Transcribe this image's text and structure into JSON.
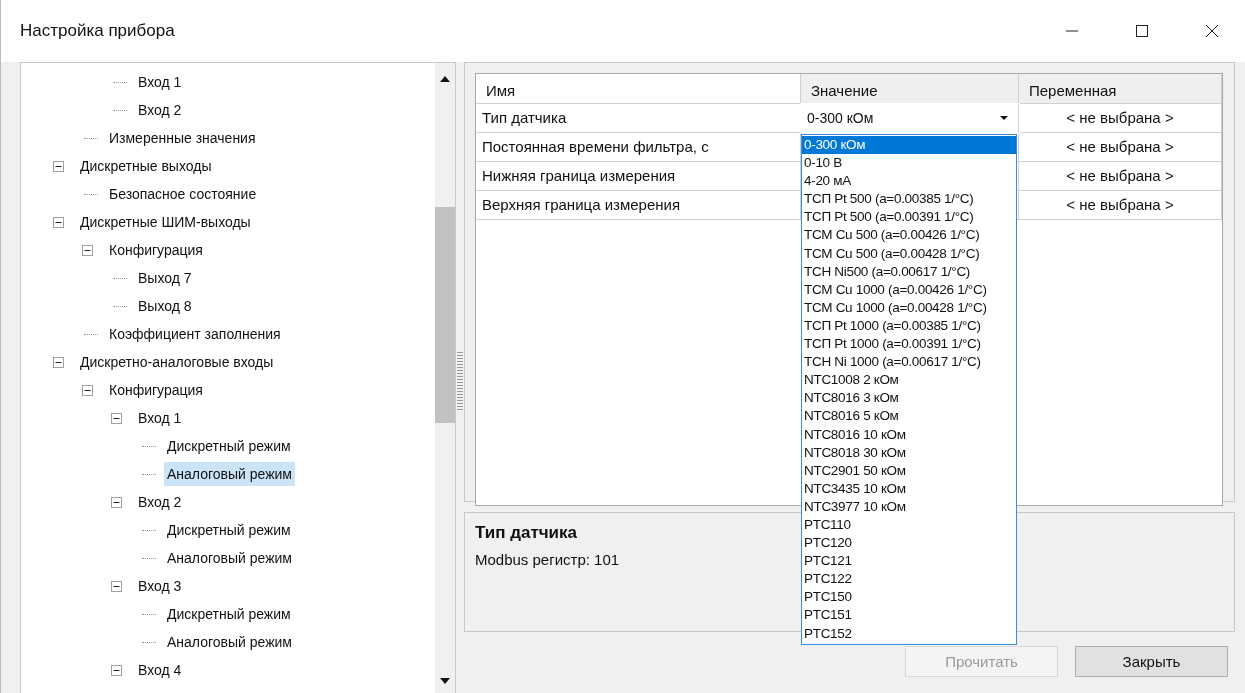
{
  "window": {
    "title": "Настройка прибора"
  },
  "tree": {
    "items": [
      {
        "children": [
          {
            "children": [
              {
                "label": "Вход 1",
                "selected": false
              },
              {
                "label": "Вход 2",
                "selected": false
              }
            ]
          },
          {
            "label": "Измеренные значения",
            "selected": false
          }
        ]
      },
      {
        "label": "Дискретные выходы",
        "expanded": true,
        "selected": false,
        "children": [
          {
            "label": "Безопасное состояние",
            "selected": false
          }
        ]
      },
      {
        "label": "Дискретные ШИМ-выходы",
        "expanded": true,
        "selected": false,
        "children": [
          {
            "label": "Конфигурация",
            "expanded": true,
            "selected": false,
            "children": [
              {
                "label": "Выход 7",
                "selected": false
              },
              {
                "label": "Выход 8",
                "selected": false
              }
            ]
          },
          {
            "label": "Коэффициент заполнения",
            "selected": false
          }
        ]
      },
      {
        "label": "Дискретно-аналоговые входы",
        "expanded": true,
        "selected": false,
        "children": [
          {
            "label": "Конфигурация",
            "expanded": true,
            "selected": false,
            "children": [
              {
                "label": "Вход 1",
                "expanded": true,
                "selected": false,
                "children": [
                  {
                    "label": "Дискретный режим",
                    "selected": false
                  },
                  {
                    "label": "Аналоговый режим",
                    "selected": true
                  }
                ]
              },
              {
                "label": "Вход 2",
                "expanded": true,
                "selected": false,
                "children": [
                  {
                    "label": "Дискретный режим",
                    "selected": false
                  },
                  {
                    "label": "Аналоговый режим",
                    "selected": false
                  }
                ]
              },
              {
                "label": "Вход 3",
                "expanded": true,
                "selected": false,
                "children": [
                  {
                    "label": "Дискретный режим",
                    "selected": false
                  },
                  {
                    "label": "Аналоговый режим",
                    "selected": false
                  }
                ]
              },
              {
                "label": "Вход 4",
                "expanded": true,
                "selected": false
              }
            ]
          }
        ]
      }
    ]
  },
  "grid": {
    "columns": [
      "Имя",
      "Значение",
      "Переменная"
    ],
    "rows": [
      {
        "kind": "combo",
        "name": "Тип датчика",
        "value": "0-300 кОм",
        "variable": "< не выбрана >",
        "expanded": true
      },
      {
        "kind": "text",
        "name": "Постоянная времени фильтра, с",
        "variable": "< не выбрана >"
      },
      {
        "kind": "text",
        "name": "Нижняя граница измерения",
        "variable": "< не выбрана >"
      },
      {
        "kind": "text",
        "name": "Верхняя граница измерения",
        "variable": "< не выбрана >"
      }
    ]
  },
  "dropdown": {
    "options": [
      {
        "label": "0-300 кОм",
        "selected": true
      },
      {
        "label": "0-10 В",
        "selected": false
      },
      {
        "label": "4-20 мА",
        "selected": false
      },
      {
        "label": "ТСП Pt 500 (a=0.00385 1/°C)",
        "selected": false
      },
      {
        "label": "ТСП Pt 500 (a=0.00391 1/°C)",
        "selected": false
      },
      {
        "label": "ТСМ Cu 500 (a=0.00426 1/°C)",
        "selected": false
      },
      {
        "label": "ТСМ Cu 500 (a=0.00428 1/°C)",
        "selected": false
      },
      {
        "label": "ТСН Ni500 (a=0.00617 1/°C)",
        "selected": false
      },
      {
        "label": "ТСМ Cu 1000 (a=0.00426 1/°C)",
        "selected": false
      },
      {
        "label": "ТСМ Cu 1000 (a=0.00428 1/°C)",
        "selected": false
      },
      {
        "label": "ТСП Pt 1000 (a=0.00385 1/°C)",
        "selected": false
      },
      {
        "label": "ТСП Pt 1000 (a=0.00391 1/°C)",
        "selected": false
      },
      {
        "label": "ТСН Ni 1000 (a=0.00617 1/°C)",
        "selected": false
      },
      {
        "label": "NTC1008 2 кОм",
        "selected": false
      },
      {
        "label": "NTC8016 3 кОм",
        "selected": false
      },
      {
        "label": "NTC8016 5 кОм",
        "selected": false
      },
      {
        "label": "NTC8016 10 кОм",
        "selected": false
      },
      {
        "label": "NTC8018 30 кОм",
        "selected": false
      },
      {
        "label": "NTC2901 50 кОм",
        "selected": false
      },
      {
        "label": "NTC3435 10 кОм",
        "selected": false
      },
      {
        "label": "NTC3977 10 кОм",
        "selected": false
      },
      {
        "label": "PTC110",
        "selected": false
      },
      {
        "label": "PTC120",
        "selected": false
      },
      {
        "label": "PTC121",
        "selected": false
      },
      {
        "label": "PTC122",
        "selected": false
      },
      {
        "label": "PTC150",
        "selected": false
      },
      {
        "label": "PTC151",
        "selected": false
      },
      {
        "label": "PTC152",
        "selected": false
      }
    ]
  },
  "description": {
    "title": "Тип датчика",
    "text": "Modbus регистр: 101"
  },
  "buttons": [
    {
      "label": "Прочитать",
      "disabled": true
    },
    {
      "label": "Закрыть",
      "disabled": false
    }
  ]
}
